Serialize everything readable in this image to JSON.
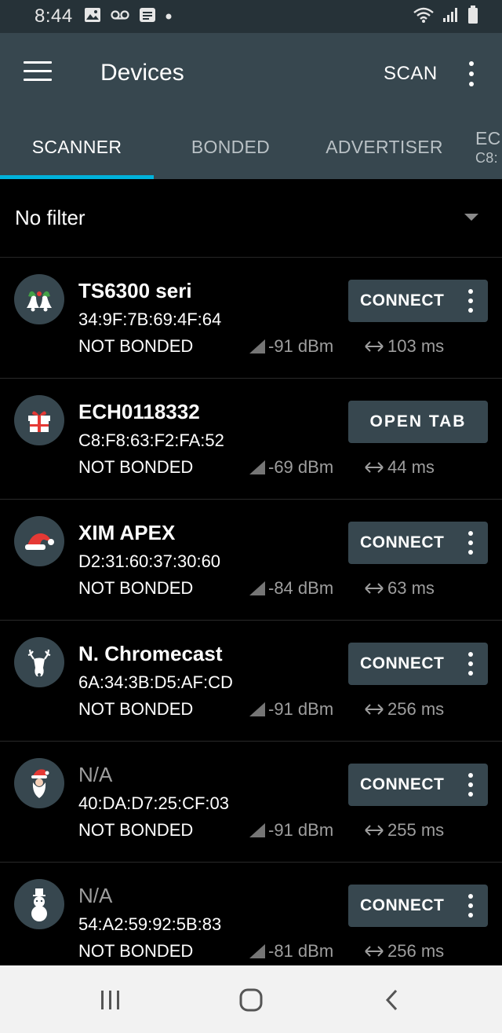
{
  "status_bar": {
    "time": "8:44",
    "icons_left": [
      "image-icon",
      "voicemail-icon",
      "message-icon",
      "dot-icon"
    ],
    "icons_right": [
      "wifi-icon",
      "signal-icon",
      "battery-icon"
    ]
  },
  "app_bar": {
    "title": "Devices",
    "scan_label": "SCAN",
    "menu_icon": "hamburger-menu-icon",
    "overflow_icon": "more-vertical-icon"
  },
  "tabs": [
    {
      "label": "SCANNER",
      "selected": true
    },
    {
      "label": "BONDED",
      "selected": false
    },
    {
      "label": "ADVERTISER",
      "selected": false
    },
    {
      "label": "EC",
      "sublabel": "C8:",
      "selected": false
    }
  ],
  "filter": {
    "label": "No filter",
    "icon": "dropdown-arrow-icon"
  },
  "devices": [
    {
      "name": "TS6300 seri",
      "address": "34:9F:7B:69:4F:64",
      "bond_state": "NOT BONDED",
      "rssi": "-91 dBm",
      "interval": "103 ms",
      "action": "CONNECT",
      "avatar": "bells-icon"
    },
    {
      "name": "ECH0118332",
      "address": "C8:F8:63:F2:FA:52",
      "bond_state": "NOT BONDED",
      "rssi": "-69 dBm",
      "interval": "44 ms",
      "action": "OPEN TAB",
      "avatar": "gift-icon"
    },
    {
      "name": "XIM APEX",
      "address": "D2:31:60:37:30:60",
      "bond_state": "NOT BONDED",
      "rssi": "-84 dBm",
      "interval": "63 ms",
      "action": "CONNECT",
      "avatar": "santa-hat-icon"
    },
    {
      "name": "N. Chromecast",
      "address": "6A:34:3B:D5:AF:CD",
      "bond_state": "NOT BONDED",
      "rssi": "-91 dBm",
      "interval": "256 ms",
      "action": "CONNECT",
      "avatar": "reindeer-icon"
    },
    {
      "name": "N/A",
      "address": "40:DA:D7:25:CF:03",
      "bond_state": "NOT BONDED",
      "rssi": "-91 dBm",
      "interval": "255 ms",
      "action": "CONNECT",
      "avatar": "santa-icon"
    },
    {
      "name": "N/A",
      "address": "54:A2:59:92:5B:83",
      "bond_state": "NOT BONDED",
      "rssi": "-81 dBm",
      "interval": "256 ms",
      "action": "CONNECT",
      "avatar": "snowman-icon"
    }
  ],
  "colors": {
    "app_bar": "#37474f",
    "status_bar": "#263238",
    "tab_indicator": "#00b3dc",
    "background": "#000000",
    "secondary_text": "#9e9e9e"
  },
  "nav_bar": {
    "icons": [
      "recent-apps-icon",
      "home-icon",
      "back-icon"
    ]
  }
}
